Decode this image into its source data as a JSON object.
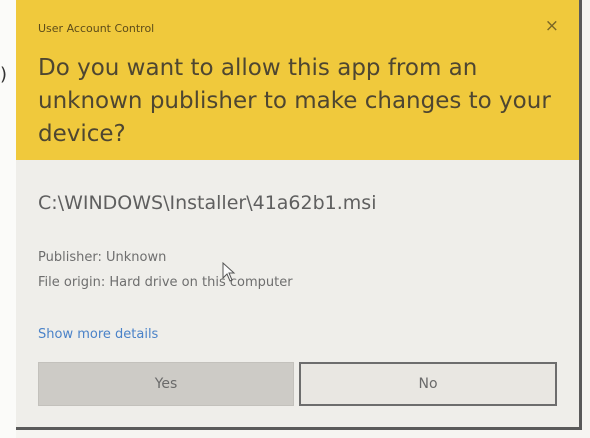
{
  "left_fragment": ")",
  "uac": {
    "window_title": "User Account Control",
    "close_glyph": "×",
    "question": "Do you want to allow this app from an unknown publisher to make changes to your device?",
    "program_path": "C:\\WINDOWS\\Installer\\41a62b1.msi",
    "publisher": "Publisher: Unknown",
    "file_origin": "File origin: Hard drive on this computer",
    "show_more_details": "Show more details",
    "yes_label": "Yes",
    "no_label": "No"
  },
  "colors": {
    "header_bg": "#f0c93c",
    "body_bg": "#efeeea",
    "link": "#4a82c8",
    "yes_button_bg": "#cdcbc6",
    "no_button_border": "#6d6d6d"
  },
  "icons": [
    "close-icon",
    "mouse-cursor-icon"
  ]
}
